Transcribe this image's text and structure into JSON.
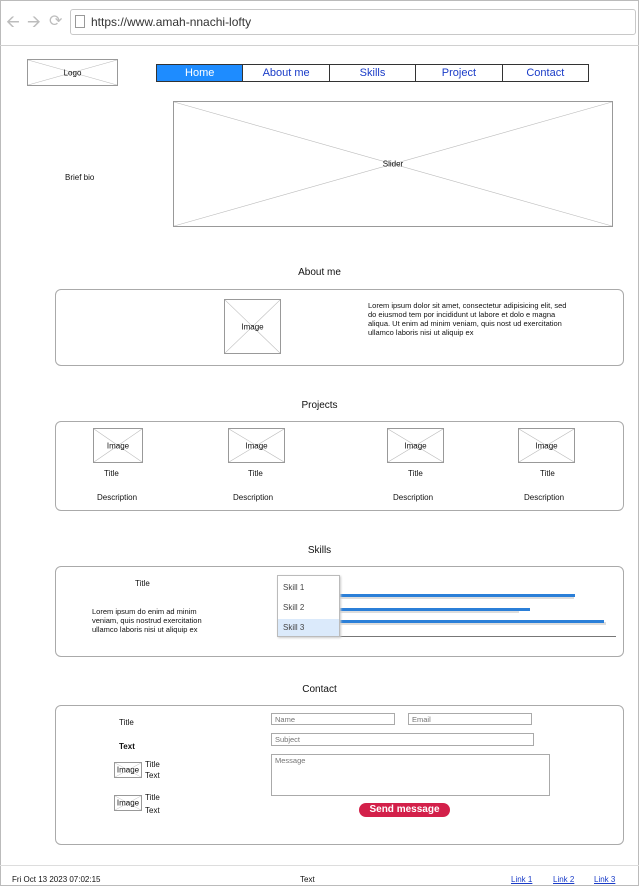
{
  "browser": {
    "url": "https://www.amah-nnachi-lofty"
  },
  "header": {
    "logo_label": "Logo"
  },
  "nav": {
    "items": [
      "Home",
      "About me",
      "Skills",
      "Project",
      "Contact"
    ],
    "active": "Home"
  },
  "hero": {
    "brief_bio": "Brief bio",
    "slider_label": "Slider"
  },
  "about": {
    "title": "About me",
    "image_label": "Image",
    "text": "Lorem ipsum dolor sit amet, consectetur adipisicing elit, sed do eiusmod tem por incididunt ut labore et dolo e magna aliqua. Ut enim ad minim veniam, quis nost ud exercitation ullamco laboris nisi ut aliquip ex"
  },
  "projects": {
    "title": "Projects",
    "items": [
      {
        "image": "Image",
        "title": "Title",
        "description": "Description"
      },
      {
        "image": "Image",
        "title": "Title",
        "description": "Description"
      },
      {
        "image": "Image",
        "title": "Title",
        "description": "Description"
      },
      {
        "image": "Image",
        "title": "Title",
        "description": "Description"
      }
    ]
  },
  "skills": {
    "title": "Skills",
    "panel_title": "Title",
    "text": "Lorem ipsum do enim ad minim veniam, quis nostrud exercitation ullamco laboris nisi ut aliquip ex",
    "list": [
      "Skill 1",
      "Skill 2",
      "Skill 3"
    ],
    "selected": "Skill 3",
    "levels": [
      0.89,
      0.72,
      1.0
    ]
  },
  "contact": {
    "title": "Contact",
    "left_title": "Title",
    "left_text": "Text",
    "cards": [
      {
        "image": "Image",
        "title": "Title",
        "text": "Text"
      },
      {
        "image": "Image",
        "title": "Title",
        "text": "Text"
      }
    ],
    "name_placeholder": "Name",
    "email_placeholder": "Email",
    "subject_placeholder": "Subject",
    "message_placeholder": "Message",
    "send_label": "Send message"
  },
  "footer": {
    "date": "Fri Oct 13 2023 07:02:15",
    "text": "Text",
    "links": [
      "Link 1",
      "Link 2",
      "Link 3"
    ]
  },
  "colors": {
    "nav_active": "#1e8cff",
    "send_button": "#d3204a",
    "skill_bar": "#2b7fd8",
    "link": "#1a3cc8"
  }
}
